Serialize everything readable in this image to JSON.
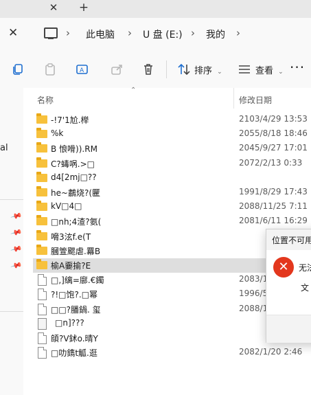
{
  "tabs": {
    "close_glyph": "✕",
    "new_tab_glyph": "+"
  },
  "address": {
    "close_glyph": "✕",
    "crumbs": [
      "此电脑",
      "U 盘 (E:)",
      "我的"
    ],
    "chevron": "›"
  },
  "command_bar": {
    "sort_label": "排序",
    "view_label": "查看",
    "more_label": "···",
    "icons": [
      "copy-icon",
      "paste-icon",
      "rename-icon",
      "share-icon",
      "delete-icon",
      "sort-icon",
      "view-icon",
      "more-icon"
    ]
  },
  "nav": {
    "partial_label": "al"
  },
  "file_list": {
    "columns": {
      "name": "名称",
      "date": "修改日期"
    },
    "rows": [
      {
        "name": "-!7'1尬.榉",
        "date": "2103/4/29 13:53",
        "type": "folder"
      },
      {
        "name": "%k",
        "date": "2055/8/18 18:46",
        "type": "folder"
      },
      {
        "name": "B 悢嗗)).RM",
        "date": "2045/9/27 17:01",
        "type": "folder"
      },
      {
        "name": "C?蝳㖞.>□",
        "date": "2072/2/13 0:33",
        "type": "folder"
      },
      {
        "name": "d4[2mj□??",
        "date": "",
        "type": "folder"
      },
      {
        "name": "he~鷫烧?(匷",
        "date": "1991/8/29 17:43",
        "type": "folder"
      },
      {
        "name": "kV□4□",
        "date": "2088/11/25 7:11",
        "type": "folder"
      },
      {
        "name": "□nh;4渣?氨(",
        "date": "2081/6/11 16:29",
        "type": "folder"
      },
      {
        "name": "嗋3泫f.e(T",
        "date": "",
        "type": "folder"
      },
      {
        "name": "膕箮颸虐.羃B",
        "date": "",
        "type": "folder"
      },
      {
        "name": "榆A嫑揄?E",
        "date": "",
        "type": "folder",
        "selected": true
      },
      {
        "name": "□,]缡=廍.€鐲",
        "date": "2083/1",
        "type": "file"
      },
      {
        "name": "?!□饱?.□幂",
        "date": "1996/5",
        "type": "file"
      },
      {
        "name": "□□?膰鍋. 玺",
        "date": "2088/1",
        "type": "file"
      },
      {
        "name": "□n]???",
        "date": "",
        "type": "file2"
      },
      {
        "name": "頧?V鉥o.晴Y",
        "date": "",
        "type": "file"
      },
      {
        "name": "□叻鐫t觚.逛",
        "date": "2082/1/20 2:46",
        "type": "file"
      }
    ]
  },
  "dialog": {
    "title": "位置不可用",
    "message_line1": "无法",
    "message_line2": "文",
    "icon_glyph": "✕",
    "accent_color": "#e3371d"
  },
  "colors": {
    "folder": "#f7c13c",
    "selected_row": "#dedede",
    "accent": "#0067c0"
  }
}
